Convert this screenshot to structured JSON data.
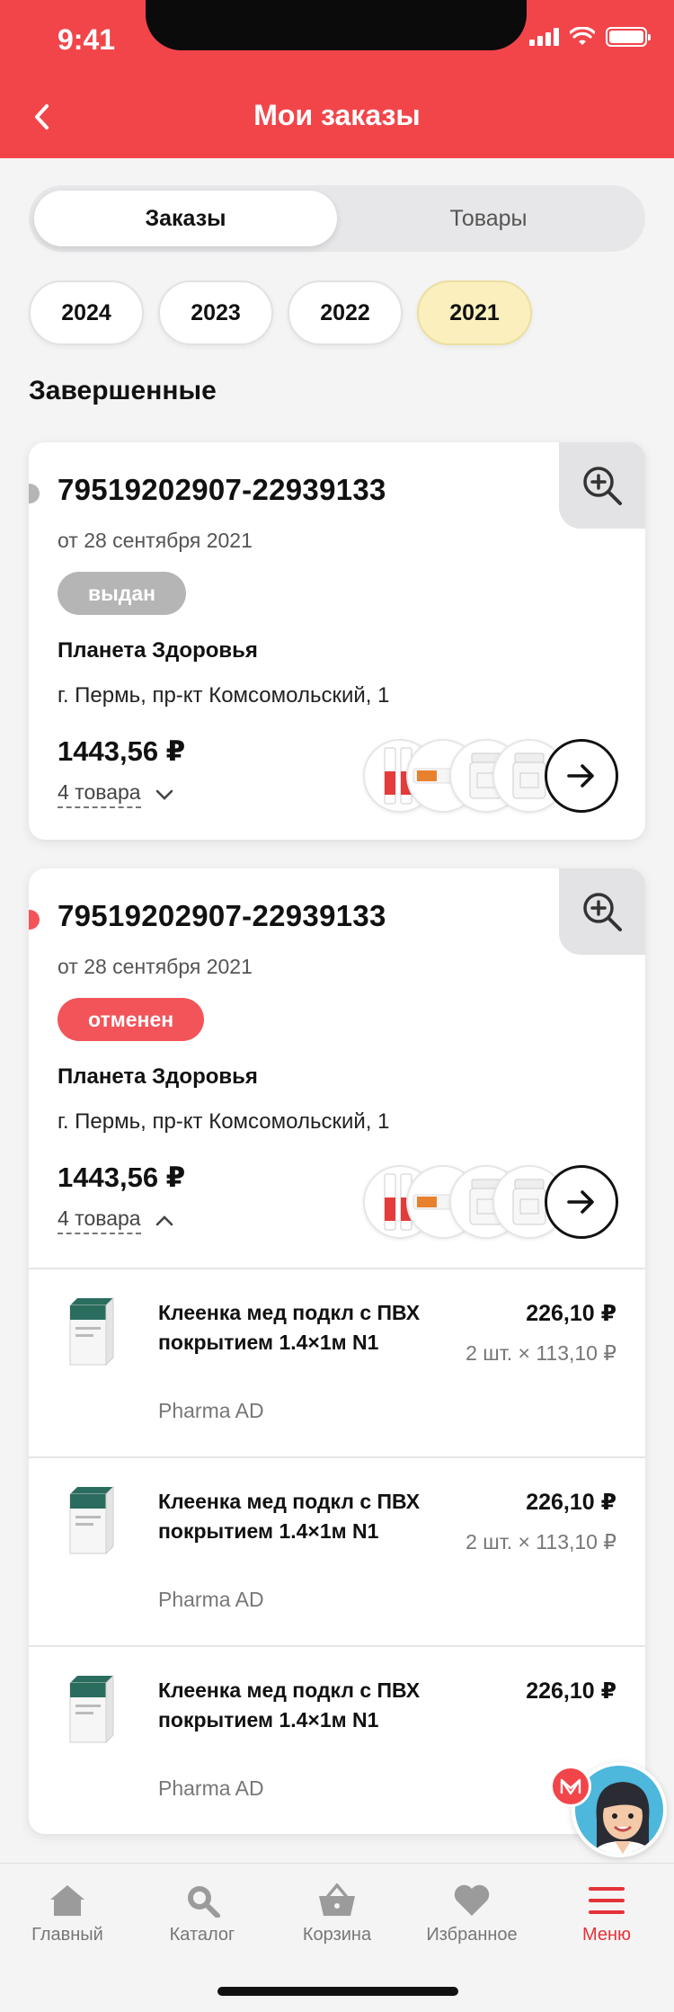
{
  "status_bar": {
    "time": "9:41"
  },
  "header": {
    "title": "Мои заказы"
  },
  "segmented": {
    "orders": "Заказы",
    "products": "Товары"
  },
  "years": [
    "2024",
    "2023",
    "2022",
    "2021"
  ],
  "section": {
    "title": "Завершенные"
  },
  "orders": [
    {
      "number": "79519202907-22939133",
      "date": "от 28 сентября 2021",
      "status": "выдан",
      "status_color": "#b5b5b5",
      "store": "Планета Здоровья",
      "address": "г. Пермь, пр-кт Комсомольский, 1",
      "price": "1443,56 ₽",
      "items_count": "4 товара"
    },
    {
      "number": "79519202907-22939133",
      "date": "от 28 сентября 2021",
      "status": "отменен",
      "status_color": "#f2545a",
      "store": "Планета Здоровья",
      "address": "г. Пермь, пр-кт Комсомольский, 1",
      "price": "1443,56 ₽",
      "items_count": "4 товара",
      "items": [
        {
          "name": "Клеенка мед подкл с ПВХ покрытием 1.4×1м N1",
          "maker": "Pharma AD",
          "price": "226,10 ₽",
          "qty": "2 шт. × 113,10 ₽"
        },
        {
          "name": "Клеенка мед подкл с ПВХ покрытием 1.4×1м N1",
          "maker": "Pharma AD",
          "price": "226,10 ₽",
          "qty": "2 шт. × 113,10 ₽"
        },
        {
          "name": "Клеенка мед подкл с ПВХ покрытием 1.4×1м N1",
          "maker": "Pharma AD",
          "price": "226,10 ₽"
        }
      ]
    }
  ],
  "tabbar": {
    "home": "Главный",
    "catalog": "Каталог",
    "cart": "Корзина",
    "favorites": "Избранное",
    "menu": "Меню"
  },
  "colors": {
    "brand": "#f2454a",
    "active_year": "#fbf0bd",
    "tab_active": "#e53238"
  }
}
